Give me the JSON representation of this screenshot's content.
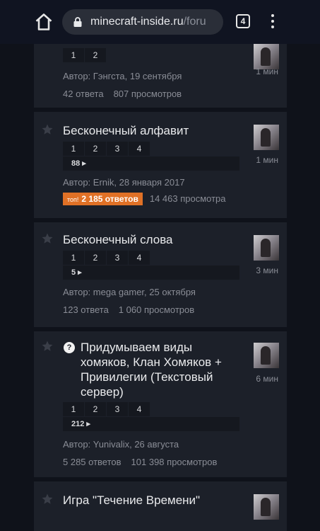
{
  "browser": {
    "url_host": "minecraft-inside.ru",
    "url_path": "/foru",
    "tab_count": "4"
  },
  "topics": [
    {
      "title": "",
      "pages": [
        "1",
        "2"
      ],
      "author": "Автор: Гэнгста, 19 сентября",
      "replies": "42 ответа",
      "views": "807 просмотров",
      "time": "1 мин"
    },
    {
      "title": "Бесконечный алфавит",
      "pages": [
        "1",
        "2",
        "3",
        "4"
      ],
      "last_page": "88",
      "author": "Автор: Ernik, 28 января 2017",
      "hot_label": "топ!",
      "replies": "2 185 ответов",
      "views": "14 463 просмотра",
      "time": "1 мин"
    },
    {
      "title": "Бесконечный слова",
      "pages": [
        "1",
        "2",
        "3",
        "4"
      ],
      "last_page": "5",
      "author": "Автор: mega gamer, 25 октября",
      "replies": "123 ответа",
      "views": "1 060 просмотров",
      "time": "3 мин"
    },
    {
      "title": "Придумываем виды хомяков, Клан Хомяков + Привилегии (Текстовый сервер)",
      "question_mark": "?",
      "pages": [
        "1",
        "2",
        "3",
        "4"
      ],
      "last_page": "212",
      "author": "Автор: Yunivalix, 26 августа",
      "replies": "5 285 ответов",
      "views": "101 398 просмотров",
      "time": "6 мин"
    },
    {
      "title": "Игра \"Течение Времени\""
    }
  ]
}
